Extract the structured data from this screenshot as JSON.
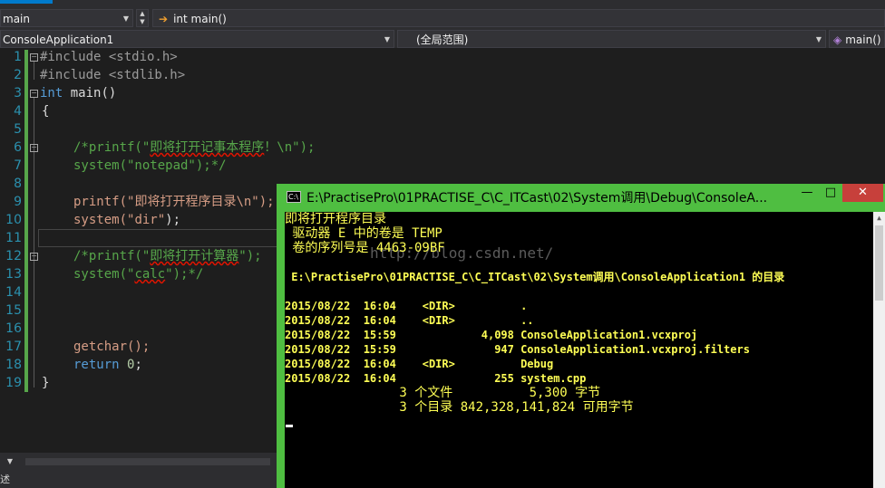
{
  "navbar": {
    "file_combo": "main",
    "function_combo": "int main()",
    "project_combo": "ConsoleApplication1",
    "scope_combo": "(全局范围)",
    "member_combo": "main()"
  },
  "editor": {
    "line_numbers": [
      "1",
      "2",
      "3",
      "4",
      "5",
      "6",
      "7",
      "8",
      "9",
      "10",
      "11",
      "12",
      "13",
      "14",
      "15",
      "16",
      "17",
      "18",
      "19"
    ],
    "line1": "#include <stdio.h>",
    "line2": "#include <stdlib.h>",
    "line3_kw": "int",
    "line3_rest": " main()",
    "line4": "{",
    "line6_a": "/*printf(\"",
    "line6_sq": "即将打开记事本程序",
    "line6_b": "！\\n\");",
    "line7": "system(\"notepad\");*/",
    "line9_fn": "printf(",
    "line9_str": "\"即将打开程序目录\\n\");",
    "line10_fn": "system(",
    "line10_str": "\"dir\"",
    "line10_end": ");",
    "line12_a": "/*printf(\"",
    "line12_sq": "即将打开计算器",
    "line12_b": "\");",
    "line13_a": "system(\"",
    "line13_sq": "calc",
    "line13_b": "\");*/",
    "line17": "getchar();",
    "line18_kw": "return",
    "line18_num": " 0",
    "line18_end": ";",
    "line19": "}"
  },
  "bottom": {
    "zoom_arrow": "▼",
    "status_text": "述"
  },
  "console": {
    "title": "E:\\PractisePro\\01PRACTISE_C\\C_ITCast\\02\\System调用\\Debug\\ConsoleA...",
    "minimize": "—",
    "maximize": "□",
    "close": "✕",
    "watermark": "http://blog.csdn.net/",
    "lines": {
      "l1": "即将打开程序目录",
      "l2": " 驱动器 E 中的卷是 TEMP",
      "l3": " 卷的序列号是 4463-09BF",
      "l4": " E:\\PractisePro\\01PRACTISE_C\\C_ITCast\\02\\System调用\\ConsoleApplication1 的目录",
      "r1": "2015/08/22  16:04    <DIR>          .",
      "r2": "2015/08/22  16:04    <DIR>          ..",
      "r3": "2015/08/22  15:59             4,098 ConsoleApplication1.vcxproj",
      "r4": "2015/08/22  15:59               947 ConsoleApplication1.vcxproj.filters",
      "r5": "2015/08/22  16:04    <DIR>          Debug",
      "r6": "2015/08/22  16:04               255 system.cpp",
      "s1": "               3 个文件          5,300 字节",
      "s2": "               3 个目录 842,328,141,824 可用字节"
    }
  },
  "colors": {
    "editor_bg": "#1e1e1e",
    "line_number": "#2b91af",
    "keyword": "#569cd6",
    "string": "#d69d85",
    "comment": "#57a64a",
    "console_frame": "#4fbe41",
    "console_text": "#ffff55",
    "close_button": "#c7403b"
  }
}
